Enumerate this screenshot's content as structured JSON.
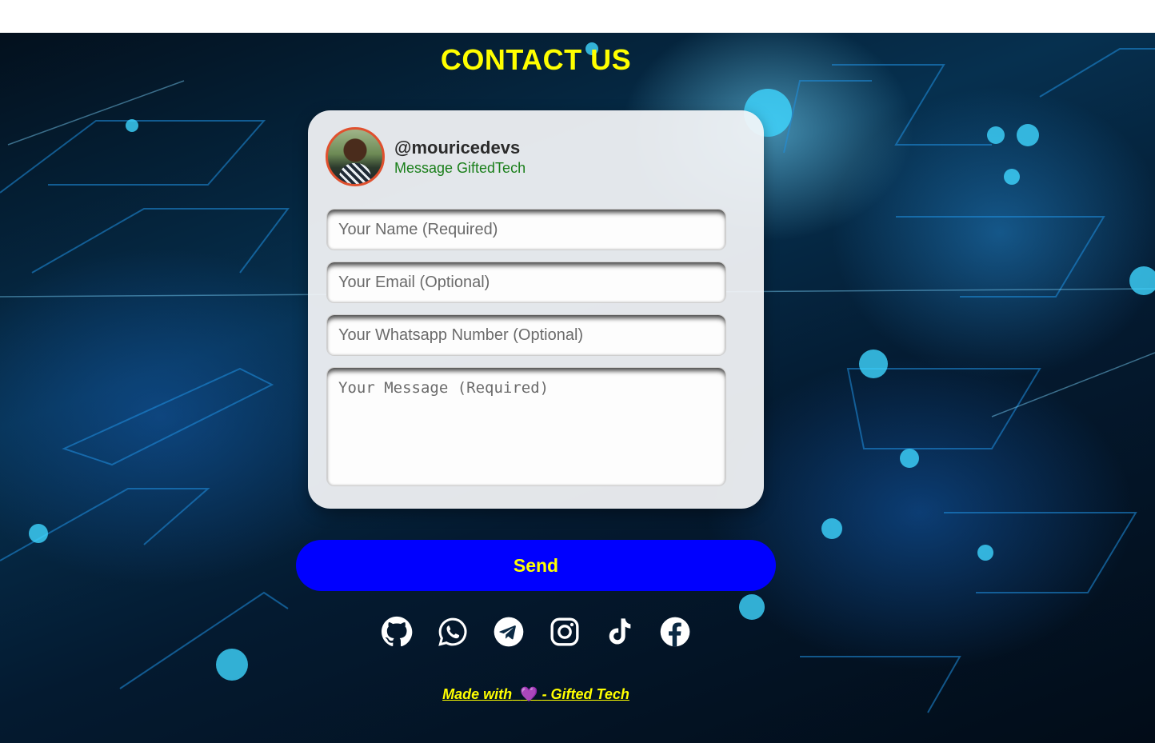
{
  "page": {
    "title": "CONTACT US"
  },
  "profile": {
    "handle": "@mouricedevs",
    "subtitle": "Message GiftedTech"
  },
  "form": {
    "name_placeholder": "Your Name (Required)",
    "email_placeholder": "Your Email (Optional)",
    "whatsapp_placeholder": "Your Whatsapp Number (Optional)",
    "message_placeholder": "Your Message (Required)",
    "send_label": "Send"
  },
  "socials": [
    {
      "icon": "github-icon"
    },
    {
      "icon": "whatsapp-icon"
    },
    {
      "icon": "telegram-icon"
    },
    {
      "icon": "instagram-icon"
    },
    {
      "icon": "tiktok-icon"
    },
    {
      "icon": "facebook-icon"
    }
  ],
  "footer": {
    "prefix": "Made with",
    "heart": "💜",
    "suffix": "- Gifted Tech"
  },
  "colors": {
    "title": "#ffff00",
    "send_button": "#0000ff",
    "send_text": "#ffff00",
    "subtitle": "#1a7f1a",
    "avatar_border": "#e0502e"
  }
}
